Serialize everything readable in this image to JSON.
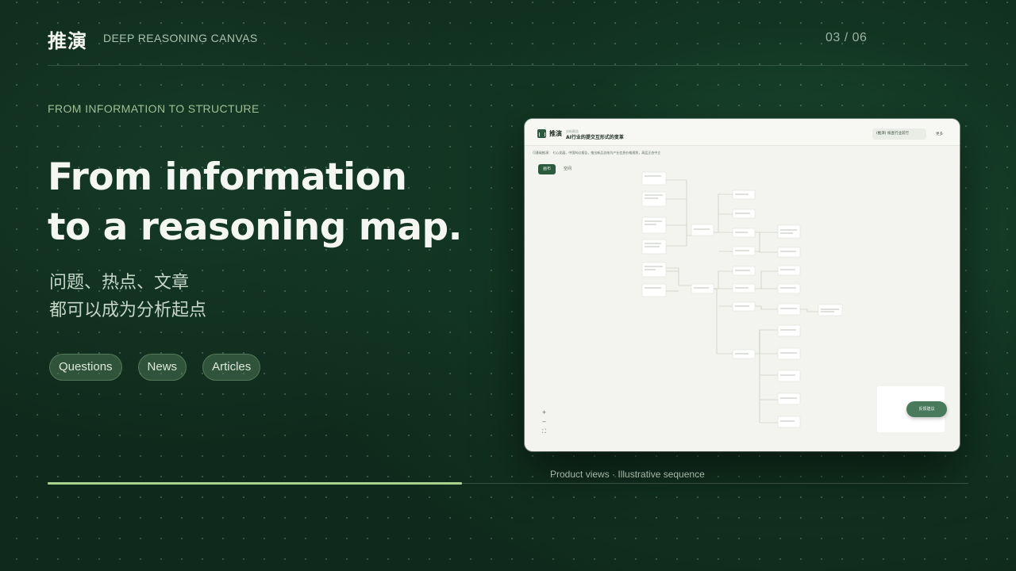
{
  "brand": "推演",
  "tagline": "DEEP REASONING CANVAS",
  "pager": "03 / 06",
  "eyebrow": "FROM INFORMATION TO STRUCTURE",
  "headline": [
    "From information",
    "to a reasoning map."
  ],
  "subtext": [
    "问题、热点、文章",
    "都可以成为分析起点"
  ],
  "chips": [
    "Questions",
    "News",
    "Articles"
  ],
  "caption": "Product views · Illustrative sequence",
  "progress_percent": 45,
  "colors": {
    "accent": "#a9d28f",
    "card_bg": "#f3f4ef",
    "app_primary": "#2b5a3e"
  },
  "screenshot": {
    "app_name": "推演",
    "breadcrumb": "分析报告",
    "doc_title": "AI行业的提交互形式的变革",
    "model_select": "(推演) 核查行业前行",
    "more": "更多",
    "info_bar": "可基础推演：  七心发展，中国科幻报告，推出新品总结为产业信息价格规划，高层正态中立",
    "tabs": [
      "画布",
      "空间"
    ],
    "zoom_controls": [
      "+",
      "−",
      "⛶"
    ],
    "feedback": "反馈建议"
  }
}
